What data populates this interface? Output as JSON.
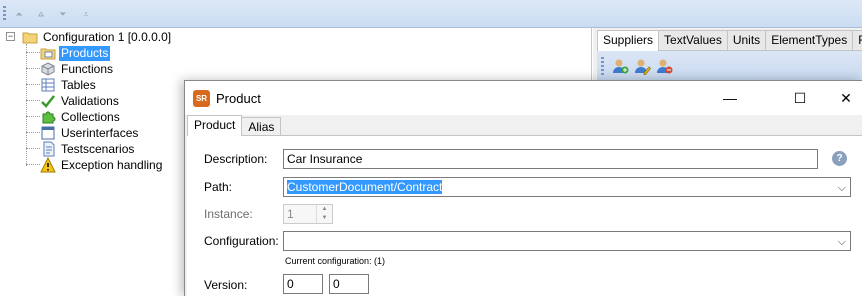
{
  "toolbar": {
    "buttons": [
      {
        "name": "move-top-icon",
        "glyph": "⏶"
      },
      {
        "name": "move-up-icon",
        "glyph": "⩠"
      },
      {
        "name": "move-down-icon",
        "glyph": "⏷"
      },
      {
        "name": "move-bottom-icon",
        "glyph": "⩡"
      }
    ]
  },
  "tree": {
    "root": {
      "label": "Configuration 1 [0.0.0.0]",
      "expander": "−"
    },
    "items": [
      {
        "label": "Products",
        "icon": "product-folder-icon",
        "selected": true
      },
      {
        "label": "Functions",
        "icon": "cube-icon"
      },
      {
        "label": "Tables",
        "icon": "table-icon"
      },
      {
        "label": "Validations",
        "icon": "checkmark-icon"
      },
      {
        "label": "Collections",
        "icon": "puzzle-icon"
      },
      {
        "label": "Userinterfaces",
        "icon": "window-icon"
      },
      {
        "label": "Testscenarios",
        "icon": "document-icon"
      },
      {
        "label": "Exception handling",
        "icon": "warning-icon"
      }
    ]
  },
  "right_panel": {
    "tabs": [
      "Suppliers",
      "TextValues",
      "Units",
      "ElementTypes",
      "Form"
    ],
    "active_tab": 0,
    "toolbar_icons": [
      "add-supplier-icon",
      "edit-supplier-icon",
      "remove-supplier-icon"
    ]
  },
  "dialog": {
    "app_icon_text": "SR",
    "title": "Product",
    "minimize": "—",
    "maximize": "☐",
    "close": "✕",
    "tabs": [
      "Product",
      "Alias"
    ],
    "active_tab": 0,
    "fields": {
      "description": {
        "label": "Description:",
        "value": "Car Insurance"
      },
      "path": {
        "label": "Path:",
        "value": "CustomerDocument/Contract"
      },
      "instance": {
        "label": "Instance:",
        "value": "1"
      },
      "configuration": {
        "label": "Configuration:",
        "value": "",
        "note": "Current configuration: (1)"
      },
      "version": {
        "label": "Version:",
        "major": "0",
        "minor": "0"
      }
    },
    "help_glyph": "?",
    "caret_glyph": "⌵",
    "spin_up": "▲",
    "spin_down": "▼"
  },
  "colors": {
    "selection": "#3399ff",
    "toolbar": "#cbdcf2",
    "app_icon": "#d86a1e"
  }
}
